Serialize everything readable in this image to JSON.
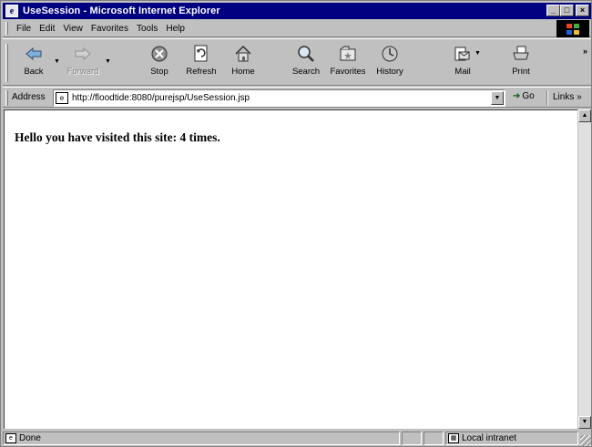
{
  "window": {
    "title": "UseSession - Microsoft Internet Explorer",
    "app_icon_glyph": "e",
    "controls": {
      "minimize": "_",
      "maximize": "□",
      "close": "×"
    }
  },
  "menu": {
    "items": [
      "File",
      "Edit",
      "View",
      "Favorites",
      "Tools",
      "Help"
    ]
  },
  "toolbar": {
    "buttons": [
      {
        "label": "Back",
        "icon": "back-arrow-icon",
        "enabled": true
      },
      {
        "label": "Forward",
        "icon": "forward-arrow-icon",
        "enabled": false
      },
      {
        "label": "Stop",
        "icon": "stop-icon",
        "enabled": true
      },
      {
        "label": "Refresh",
        "icon": "refresh-icon",
        "enabled": true
      },
      {
        "label": "Home",
        "icon": "home-icon",
        "enabled": true
      },
      {
        "label": "Search",
        "icon": "search-icon",
        "enabled": true
      },
      {
        "label": "Favorites",
        "icon": "favorites-icon",
        "enabled": true
      },
      {
        "label": "History",
        "icon": "history-icon",
        "enabled": true
      },
      {
        "label": "Mail",
        "icon": "mail-icon",
        "enabled": true
      },
      {
        "label": "Print",
        "icon": "print-icon",
        "enabled": true
      }
    ],
    "more_glyph": "»"
  },
  "address": {
    "label": "Address",
    "url": "http://floodtide:8080/purejsp/UseSession.jsp",
    "go_label": "Go",
    "links_label": "Links »"
  },
  "page": {
    "message": "Hello you have visited this site: 4 times."
  },
  "status": {
    "text": "Done",
    "zone": "Local intranet"
  }
}
